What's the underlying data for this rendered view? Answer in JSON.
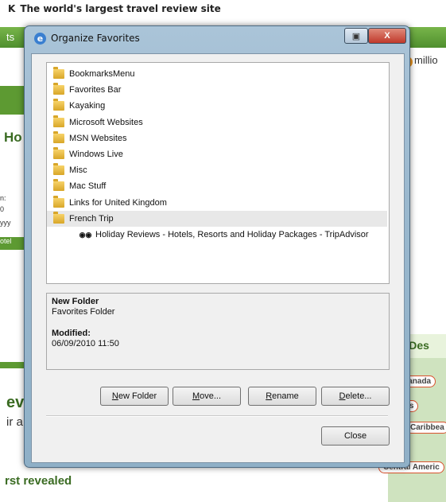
{
  "background": {
    "site_tagline": "The world's largest travel review site",
    "site_letter": "K",
    "nav_fragment": "ts",
    "millions_fragment": "millio",
    "million_badge": "5",
    "heading_fragment": "Ho",
    "left_field_fragments": [
      "n:",
      "0",
      "yyy"
    ],
    "left_button_fragment": "otel",
    "ev_fragment": "ev",
    "ir_fragment": "ir a",
    "revealed_fragment": "rst revealed",
    "by_destination_fragment": "by Des",
    "map_pills": [
      "Canada",
      "tes",
      "Caribbea",
      "Central Americ"
    ]
  },
  "dialog": {
    "title": "Organize Favorites",
    "close_glyph": "X",
    "restore_glyph": "▣",
    "tree": [
      {
        "label": "BookmarksMenu",
        "type": "folder",
        "indent": 0
      },
      {
        "label": "Favorites Bar",
        "type": "folder",
        "indent": 0
      },
      {
        "label": "Kayaking",
        "type": "folder",
        "indent": 0
      },
      {
        "label": "Microsoft Websites",
        "type": "folder",
        "indent": 0
      },
      {
        "label": "MSN Websites",
        "type": "folder",
        "indent": 0
      },
      {
        "label": "Windows Live",
        "type": "folder",
        "indent": 0
      },
      {
        "label": "Misc",
        "type": "folder",
        "indent": 0
      },
      {
        "label": "Mac Stuff",
        "type": "folder",
        "indent": 0
      },
      {
        "label": "Links for United Kingdom",
        "type": "folder",
        "indent": 0
      },
      {
        "label": "French Trip",
        "type": "folder",
        "indent": 0,
        "selected": true
      },
      {
        "label": "Holiday Reviews - Hotels, Resorts and Holiday Packages - TripAdvisor",
        "type": "link",
        "indent": 1
      }
    ],
    "info": {
      "name": "New Folder",
      "kind": "Favorites Folder",
      "modified_label": "Modified:",
      "modified_value": "06/09/2010 11:50"
    },
    "buttons": {
      "new_folder": "New Folder",
      "move": "Move...",
      "rename": "Rename",
      "delete": "Delete...",
      "close": "Close"
    },
    "owl_icon": "owl-icon",
    "folder_icon": "folder-icon"
  }
}
